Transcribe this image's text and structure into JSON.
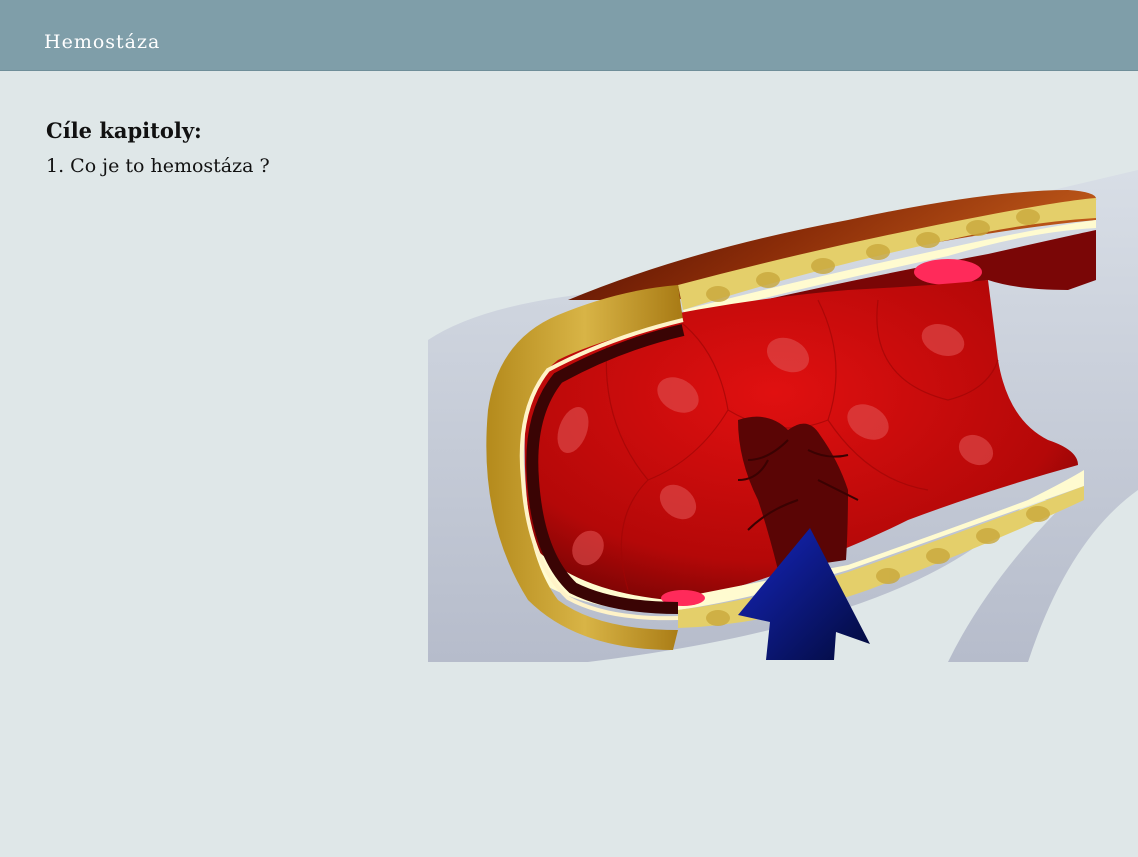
{
  "header": {
    "title": "Hemostáza"
  },
  "content": {
    "heading": "Cíle kapitoly:",
    "objectives": [
      "1. Co je to hemostáza ?"
    ]
  },
  "illustration": {
    "subject": "blood-vessel-cross-section-injury",
    "arrow_color": "#0a1a8c",
    "vessel_color": "#c80a0a",
    "wall_color": "#d8be5a"
  }
}
